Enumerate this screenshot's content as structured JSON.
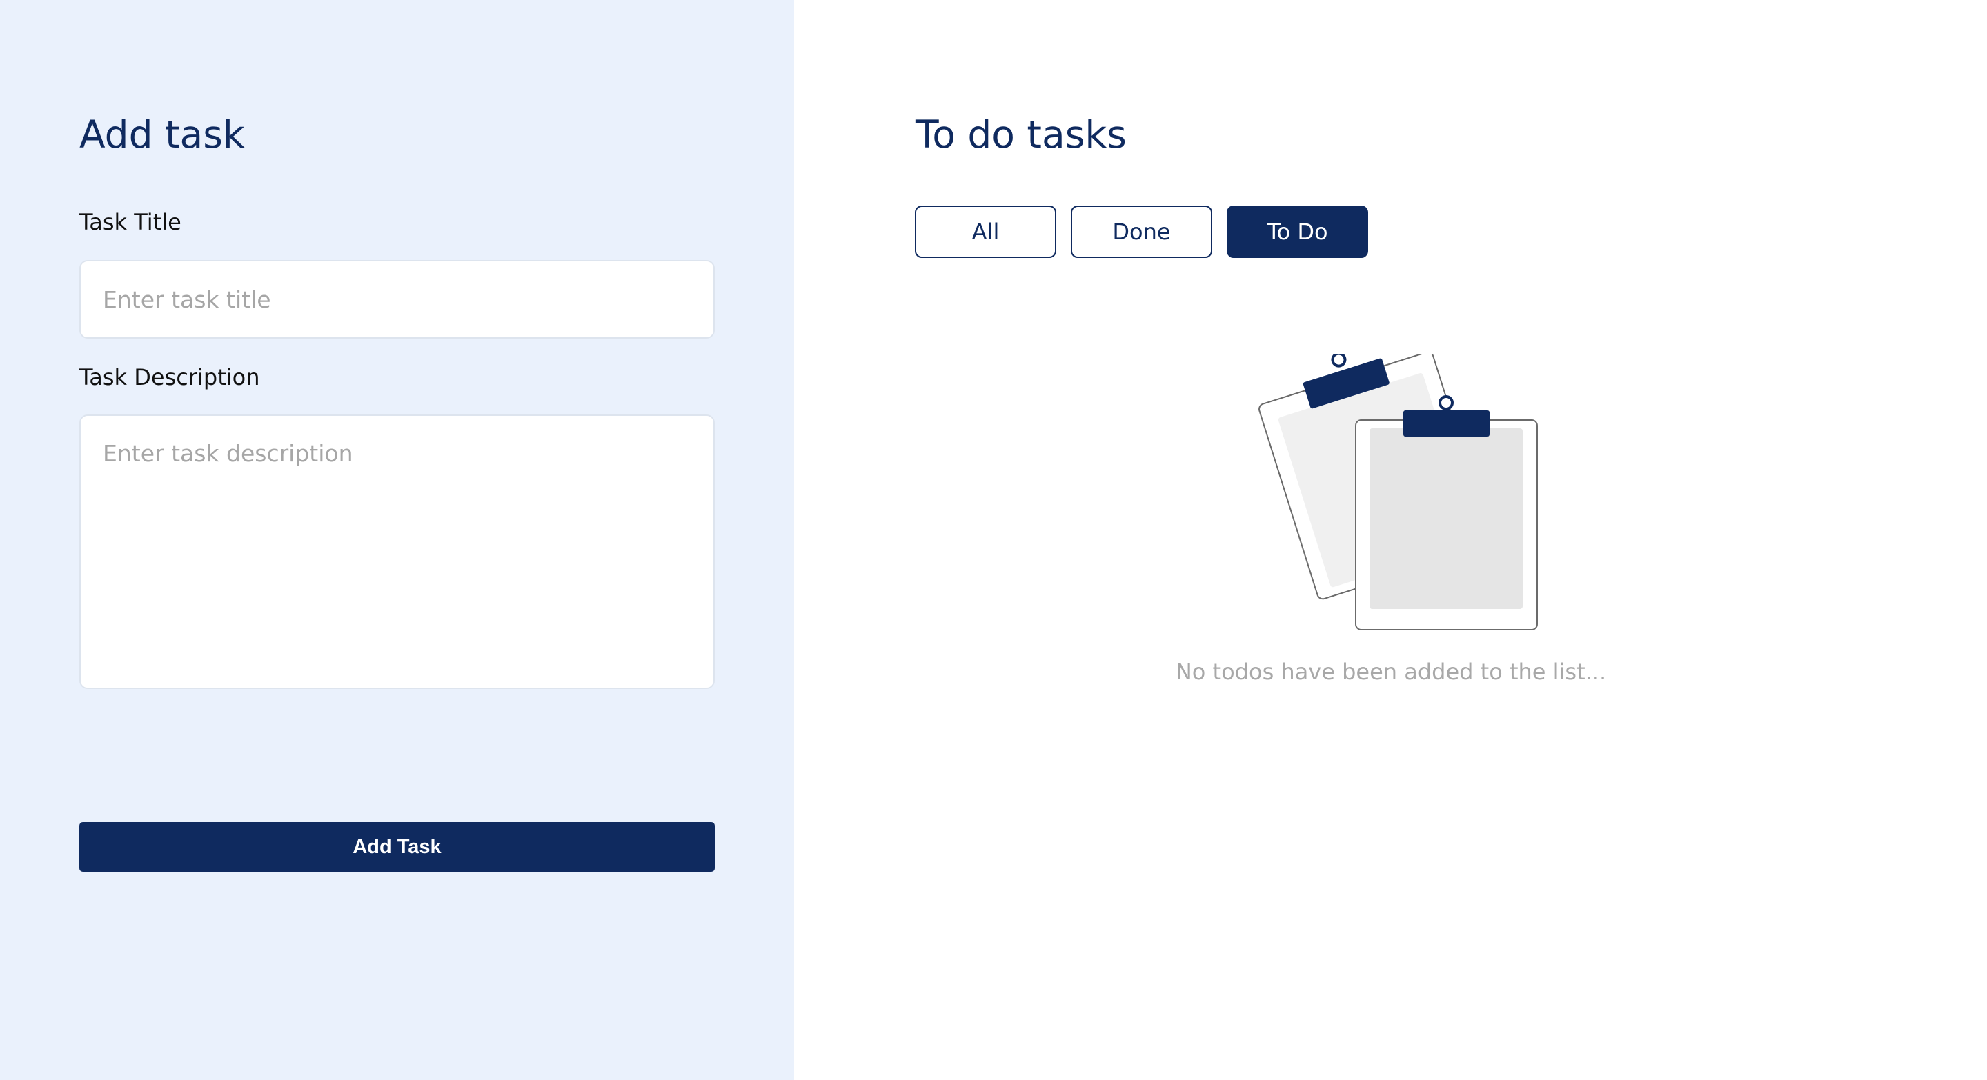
{
  "add_panel": {
    "title": "Add task",
    "task_title_label": "Task Title",
    "task_title_placeholder": "Enter task title",
    "task_title_value": "",
    "task_description_label": "Task Description",
    "task_description_placeholder": "Enter task description",
    "task_description_value": "",
    "submit_label": "Add Task"
  },
  "list_panel": {
    "title": "To do tasks",
    "filters": [
      {
        "label": "All",
        "active": false
      },
      {
        "label": "Done",
        "active": false
      },
      {
        "label": "To Do",
        "active": true
      }
    ],
    "empty_state": {
      "illustration_icon": "clipboards-empty-icon",
      "message": "No todos have been added to the list..."
    }
  },
  "colors": {
    "brand_navy": "#0f2a5f",
    "left_panel_bg": "#eaf1fc",
    "right_panel_bg": "#ffffff",
    "placeholder_gray": "#a6a6a6",
    "empty_text_gray": "#a8a8a8"
  }
}
